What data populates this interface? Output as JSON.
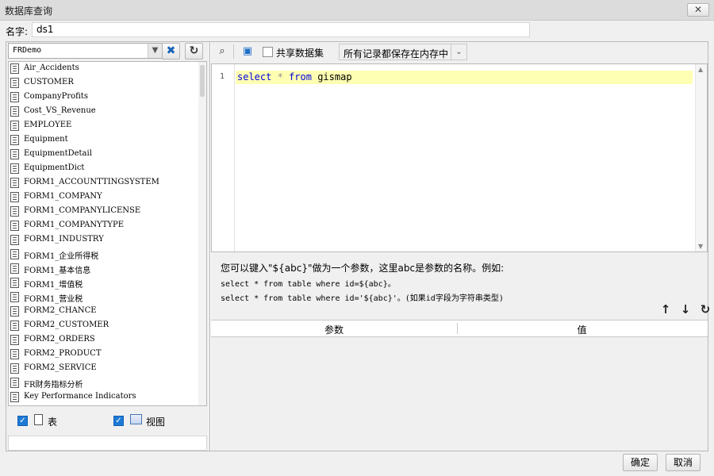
{
  "window": {
    "title": "数据库查询",
    "close_label": "✕"
  },
  "name": {
    "label": "名字:",
    "value": "ds1"
  },
  "left": {
    "db_select": "FRDemo",
    "tables": [
      "Air_Accidents",
      "CUSTOMER",
      "CompanyProfits",
      "Cost_VS_Revenue",
      "EMPLOYEE",
      "Equipment",
      "EquipmentDetail",
      "EquipmentDict",
      "FORM1_ACCOUNTTINGSYSTEM",
      "FORM1_COMPANY",
      "FORM1_COMPANYLICENSE",
      "FORM1_COMPANYTYPE",
      "FORM1_INDUSTRY",
      "FORM1_企业所得税",
      "FORM1_基本信息",
      "FORM1_增值税",
      "FORM1_营业税",
      "FORM2_CHANCE",
      "FORM2_CUSTOMER",
      "FORM2_ORDERS",
      "FORM2_PRODUCT",
      "FORM2_SERVICE",
      "FR财务指标分析",
      "Key Performance Indicators"
    ],
    "check_table_label": "表",
    "check_view_label": "视图"
  },
  "toolbar": {
    "share_label": "共享数据集",
    "cache_select": "所有记录都保存在内存中"
  },
  "editor": {
    "line_number": "1",
    "code": {
      "kw1": "select",
      "op": "*",
      "kw2": "from",
      "rest": "gismap"
    }
  },
  "help": {
    "line1": "您可以键入\"${abc}\"做为一个参数，这里abc是参数的名称。例如:",
    "line2": "select * from table where id=${abc}。",
    "line3": "select * from table where id='${abc}'。(如果id字段为字符串类型)"
  },
  "params": {
    "col_param": "参数",
    "col_value": "值"
  },
  "footer": {
    "ok_label": "确定",
    "cancel_label": "取消"
  }
}
